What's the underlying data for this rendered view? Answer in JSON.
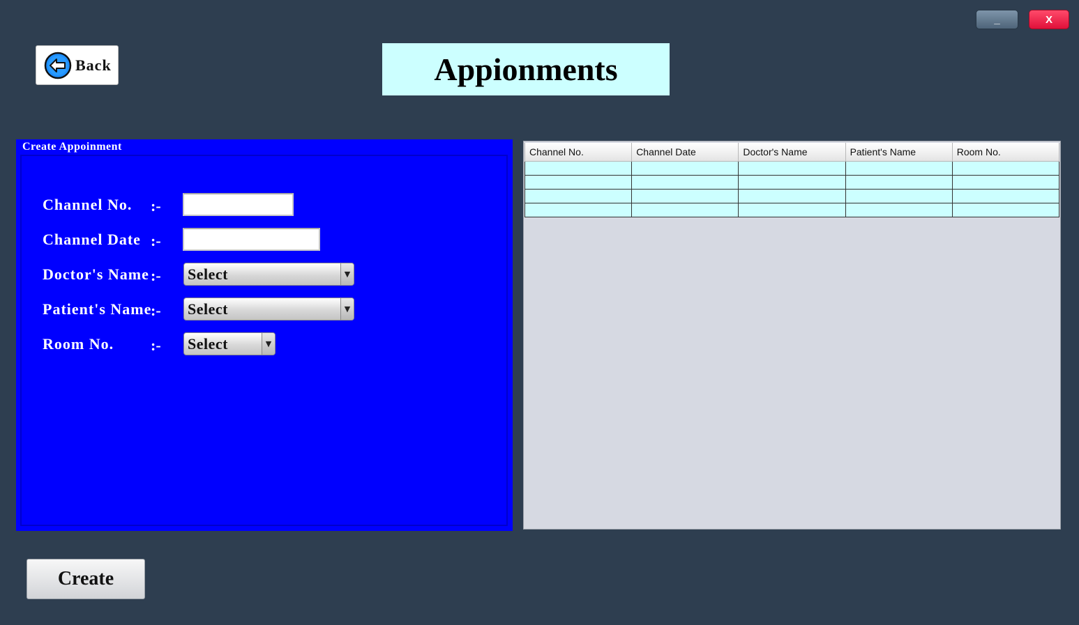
{
  "window": {
    "minimize_label": "_",
    "close_label": "X",
    "minimize_color": "#5f768c",
    "close_color": "#f2254d"
  },
  "header": {
    "back_label": "Back",
    "back_icon": "arrow-left-circle-icon",
    "title": "Appionments",
    "title_bg": "#ccffff"
  },
  "form": {
    "panel_title": "Create Appoinment",
    "panel_color": "#0000ff",
    "fields": {
      "channel_no": {
        "label": "Channel No.",
        "sep": ":-",
        "value": ""
      },
      "channel_date": {
        "label": "Channel Date",
        "sep": ":-",
        "value": ""
      },
      "doctor": {
        "label": "Doctor's Name",
        "sep": ":-",
        "selected": "Select"
      },
      "patient": {
        "label": "Patient's Name",
        "sep": ":-",
        "selected": "Select"
      },
      "room": {
        "label": "Room No.",
        "sep": ":-",
        "selected": "Select"
      }
    },
    "dropdown_arrow": "▼"
  },
  "table": {
    "columns": [
      "Channel No.",
      "Channel Date",
      "Doctor's Name",
      "Patient's Name",
      "Room No."
    ],
    "rows": [
      [
        "",
        "",
        "",
        "",
        ""
      ],
      [
        "",
        "",
        "",
        "",
        ""
      ],
      [
        "",
        "",
        "",
        "",
        ""
      ],
      [
        "",
        "",
        "",
        "",
        ""
      ]
    ],
    "row_color": "#ccffff"
  },
  "actions": {
    "create_label": "Create"
  }
}
